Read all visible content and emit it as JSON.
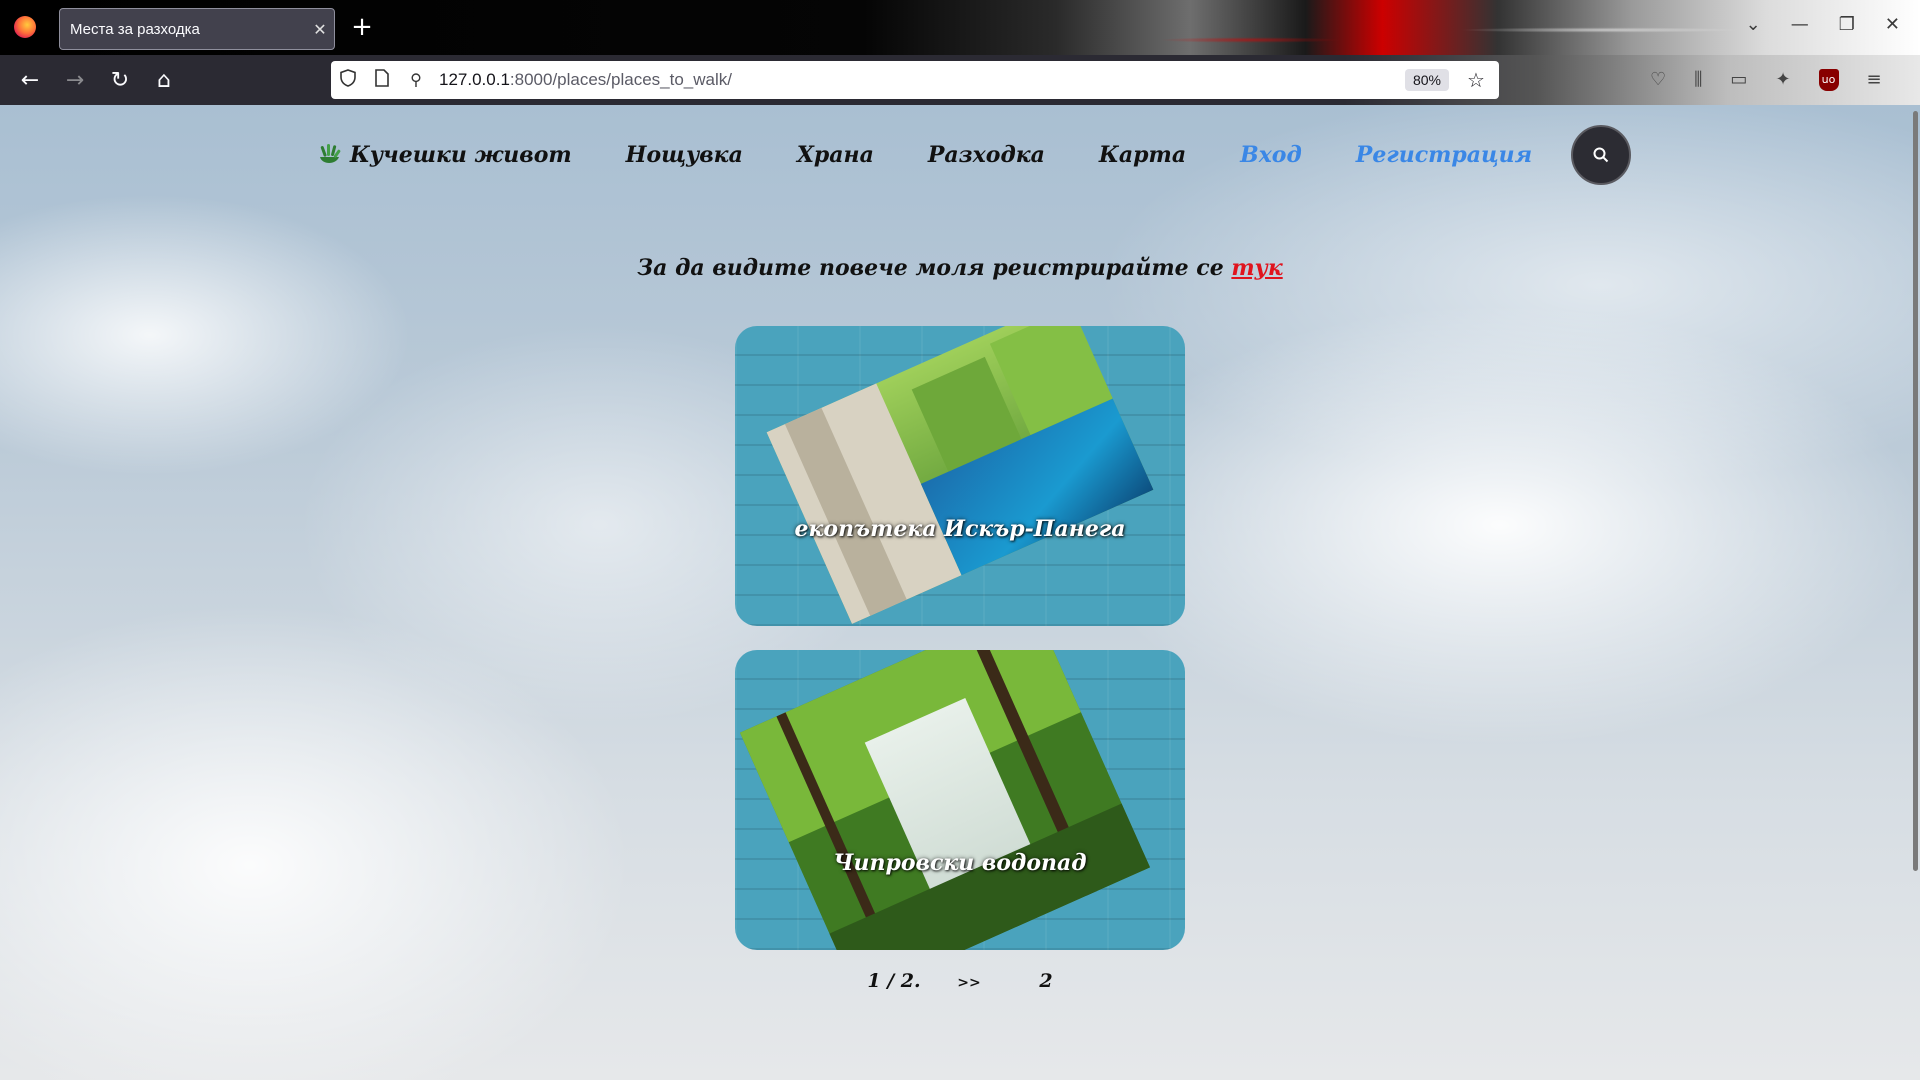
{
  "browser": {
    "tab_title": "Места за разходка",
    "url_host": "127.0.0.1",
    "url_path": ":8000/places/places_to_walk/",
    "zoom": "80%"
  },
  "site": {
    "brand": "Кучешки живот",
    "nav": [
      "Нощувка",
      "Храна",
      "Разходка",
      "Карта"
    ],
    "login": "Вход",
    "register": "Регистрация"
  },
  "message": {
    "text": "За да видите повече моля реистрирайте се ",
    "link": "тук"
  },
  "places": [
    {
      "title": "екопътека Искър-Панега"
    },
    {
      "title": "Чипровски водопад"
    }
  ],
  "pagination": {
    "current": "1 / 2.",
    "next": ">>",
    "last": "2"
  },
  "colors": {
    "card_bg": "#4aa3bd",
    "link_blue": "#3a87e6",
    "link_red": "#e0141e"
  }
}
